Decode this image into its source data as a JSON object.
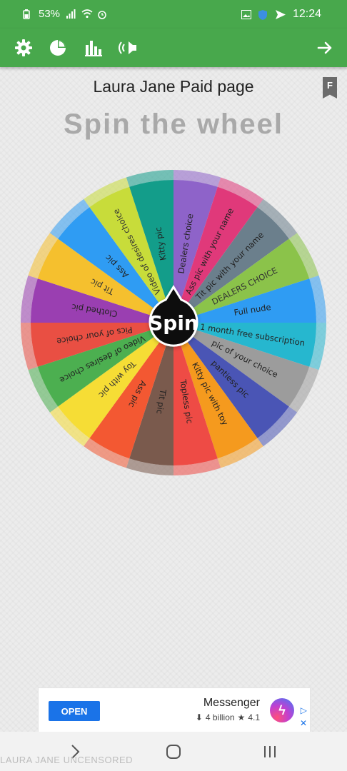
{
  "status": {
    "time": "12:24",
    "battery": "53%"
  },
  "header": {
    "title": "Laura Jane Paid page",
    "subtitle": "Spin the wheel",
    "bookmark_letter": "F"
  },
  "wheel": {
    "center_label": "Spin",
    "segments": [
      {
        "label": "Dealers choice",
        "color": "#8e63c9"
      },
      {
        "label": "Ass pic with your name",
        "color": "#e0397a"
      },
      {
        "label": "Tit pic with your name",
        "color": "#6b7f8c"
      },
      {
        "label": "DEALERS CHOICE",
        "color": "#8bc34a"
      },
      {
        "label": "Full nude",
        "color": "#2f9cf3"
      },
      {
        "label": "1 month free subscription",
        "color": "#26b7cf"
      },
      {
        "label": "pic of your choice",
        "color": "#9c9c9c"
      },
      {
        "label": "pantiess pic",
        "color": "#4a55b5"
      },
      {
        "label": "Kitty pic with toy",
        "color": "#f59a1e"
      },
      {
        "label": "Topless pic",
        "color": "#ee4b45"
      },
      {
        "label": "Tit pic",
        "color": "#7a5a4d"
      },
      {
        "label": "Ass pic",
        "color": "#f35832"
      },
      {
        "label": "Toy with pic",
        "color": "#f6dd35"
      },
      {
        "label": "Video of desires choice",
        "color": "#4caf50"
      },
      {
        "label": "Pics of your choice",
        "color": "#e94f43"
      },
      {
        "label": "Clothed pic",
        "color": "#9a3fb1"
      },
      {
        "label": "Tit pic",
        "color": "#f5c02e"
      },
      {
        "label": "Ass pic",
        "color": "#2f9cf3"
      },
      {
        "label": "Video of desires choice",
        "color": "#c8dc3a"
      },
      {
        "label": "Kitty pic",
        "color": "#139d8a"
      }
    ]
  },
  "ad": {
    "app_name": "Messenger",
    "rating": "4.1",
    "downloads": "4 billion",
    "open_label": "OPEN"
  },
  "watermark": "LAURA JANE UNCENSORED"
}
